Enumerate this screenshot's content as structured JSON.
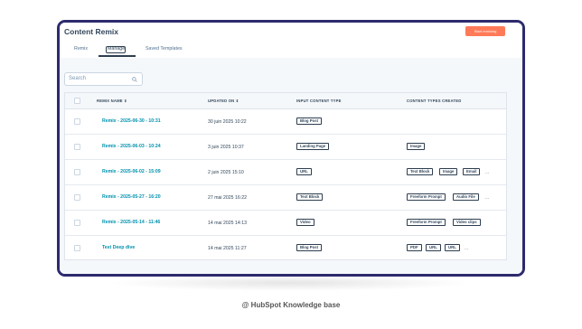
{
  "app": {
    "title": "Content Remix",
    "start_button": "Start remixing"
  },
  "tabs": [
    {
      "label": "Remix"
    },
    {
      "label": "Manage"
    },
    {
      "label": "Saved Templates"
    }
  ],
  "search": {
    "placeholder": "Search"
  },
  "table": {
    "headers": {
      "name": "REMIX NAME",
      "updated": "UPDATED ON",
      "input": "INPUT CONTENT TYPE",
      "created": "CONTENT TYPES CREATED"
    },
    "rows": [
      {
        "name": "Remix - 2025-06-30 - 10:31",
        "updated": "30 juin 2025 10:22",
        "input": "Blog Post",
        "created": [],
        "more": ""
      },
      {
        "name": "Remix - 2025-06-03 - 10:24",
        "updated": "3 juin 2025 10:37",
        "input": "Landing Page",
        "created": [
          "Image"
        ],
        "more": ""
      },
      {
        "name": "Remix - 2025-06-02 - 15:09",
        "updated": "2 juin 2025 15:10",
        "input": "URL",
        "created": [
          "Text Block",
          "Image",
          "Email"
        ],
        "more": "..."
      },
      {
        "name": "Remix - 2025-05-27 - 16:20",
        "updated": "27 mai 2025 16:22",
        "input": "Text Block",
        "created": [
          "Freeform Prompt",
          "Audio File"
        ],
        "more": "..."
      },
      {
        "name": "Remix - 2025-05-14 - 11:46",
        "updated": "14 mai 2025 14:13",
        "input": "Video",
        "created": [
          "Freeform Prompt",
          "Video clips"
        ],
        "more": ""
      },
      {
        "name": "Test Deep dive",
        "updated": "14 mai 2025 11:27",
        "input": "Blog Post",
        "created": [
          "PDF",
          "URL",
          "URL"
        ],
        "more": "..."
      }
    ]
  },
  "footer": {
    "text": "@ HubSpot Knowledge base"
  }
}
